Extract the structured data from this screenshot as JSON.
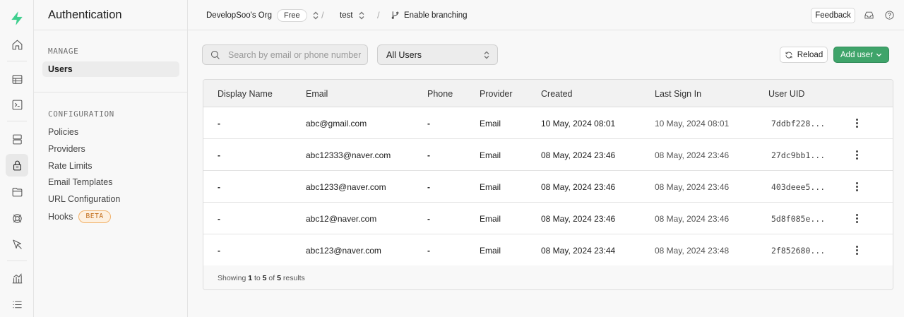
{
  "rail": {
    "items": [
      {
        "icon": "supabase-logo-icon"
      },
      {
        "icon": "home-icon"
      },
      {
        "icon": "table-editor-icon"
      },
      {
        "icon": "sql-editor-icon"
      },
      {
        "icon": "database-icon"
      },
      {
        "icon": "authentication-icon"
      },
      {
        "icon": "storage-icon"
      },
      {
        "icon": "realtime-icon"
      },
      {
        "icon": "edge-functions-icon"
      },
      {
        "icon": "reports-icon"
      },
      {
        "icon": "logs-icon"
      }
    ],
    "brand_color": "#3ecf8e"
  },
  "menu": {
    "title": "Authentication",
    "manage_heading": "MANAGE",
    "manage_items": [
      "Users"
    ],
    "config_heading": "CONFIGURATION",
    "config_items": [
      "Policies",
      "Providers",
      "Rate Limits",
      "Email Templates",
      "URL Configuration",
      "Hooks"
    ],
    "hooks_badge": "BETA"
  },
  "topbar": {
    "org": "DevelopSoo's Org",
    "plan": "Free",
    "project": "test",
    "branching": "Enable branching",
    "feedback": "Feedback"
  },
  "toolbar": {
    "search_placeholder": "Search by email or phone number",
    "filter_value": "All Users",
    "reload": "Reload",
    "add_user": "Add user",
    "accent": "#3fa46a"
  },
  "table": {
    "columns": [
      "Display Name",
      "Email",
      "Phone",
      "Provider",
      "Created",
      "Last Sign In",
      "User UID"
    ],
    "rows": [
      {
        "display_name": "-",
        "email": "abc@gmail.com",
        "phone": "-",
        "provider": "Email",
        "created": "10 May, 2024 08:01",
        "last_sign_in": "10 May, 2024 08:01",
        "uid": "7ddbf228..."
      },
      {
        "display_name": "-",
        "email": "abc12333@naver.com",
        "phone": "-",
        "provider": "Email",
        "created": "08 May, 2024 23:46",
        "last_sign_in": "08 May, 2024 23:46",
        "uid": "27dc9bb1..."
      },
      {
        "display_name": "-",
        "email": "abc1233@naver.com",
        "phone": "-",
        "provider": "Email",
        "created": "08 May, 2024 23:46",
        "last_sign_in": "08 May, 2024 23:46",
        "uid": "403deee5..."
      },
      {
        "display_name": "-",
        "email": "abc12@naver.com",
        "phone": "-",
        "provider": "Email",
        "created": "08 May, 2024 23:46",
        "last_sign_in": "08 May, 2024 23:46",
        "uid": "5d8f085e..."
      },
      {
        "display_name": "-",
        "email": "abc123@naver.com",
        "phone": "-",
        "provider": "Email",
        "created": "08 May, 2024 23:44",
        "last_sign_in": "08 May, 2024 23:48",
        "uid": "2f852680..."
      }
    ],
    "footer": {
      "prefix": "Showing",
      "from": "1",
      "to_word": "to",
      "to": "5",
      "of_word": "of",
      "total": "5",
      "suffix": "results"
    }
  }
}
